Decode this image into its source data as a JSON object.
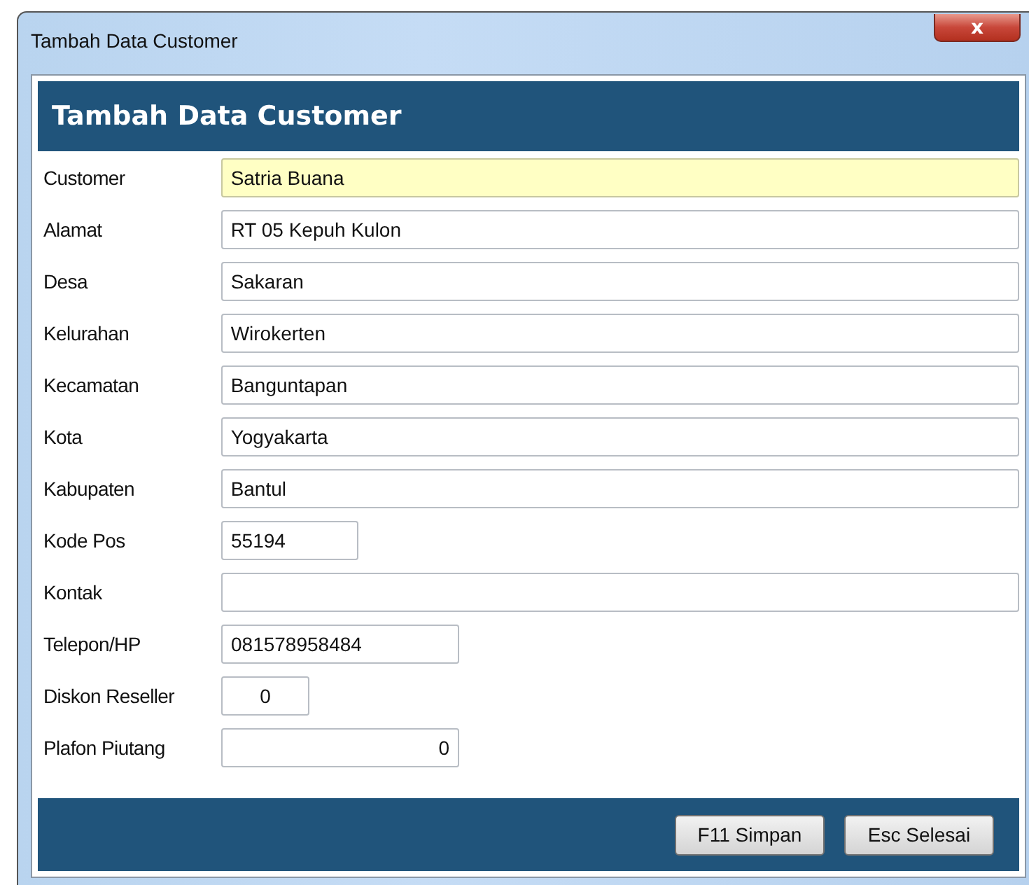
{
  "window": {
    "title": "Tambah Data Customer",
    "close_label": "x"
  },
  "header": "Tambah Data Customer",
  "fields": [
    {
      "label": "Customer",
      "value": "Satria Buana",
      "kind": "text",
      "focused": true
    },
    {
      "label": "Alamat",
      "value": "RT 05 Kepuh Kulon",
      "kind": "text",
      "focused": false
    },
    {
      "label": "Desa",
      "value": "Sakaran",
      "kind": "text",
      "focused": false
    },
    {
      "label": "Kelurahan",
      "value": "Wirokerten",
      "kind": "text",
      "focused": false
    },
    {
      "label": "Kecamatan",
      "value": "Banguntapan",
      "kind": "text",
      "focused": false
    },
    {
      "label": "Kota",
      "value": "Yogyakarta",
      "kind": "text",
      "focused": false
    },
    {
      "label": "Kabupaten",
      "value": "Bantul",
      "kind": "text",
      "focused": false
    },
    {
      "label": "Kode Pos",
      "value": "55194",
      "kind": "postcode",
      "focused": false
    },
    {
      "label": "Kontak",
      "kind": "text",
      "focused": false
    },
    {
      "label": "Telepon/HP",
      "value": "081578958484",
      "kind": "phone",
      "focused": false
    },
    {
      "label": "Diskon Reseller",
      "value": "0",
      "kind": "percent",
      "focused": false
    },
    {
      "label": "Plafon Piutang",
      "value": "0",
      "kind": "amount",
      "focused": false
    }
  ],
  "buttons": [
    "F11 Simpan",
    "Esc Selesai"
  ]
}
